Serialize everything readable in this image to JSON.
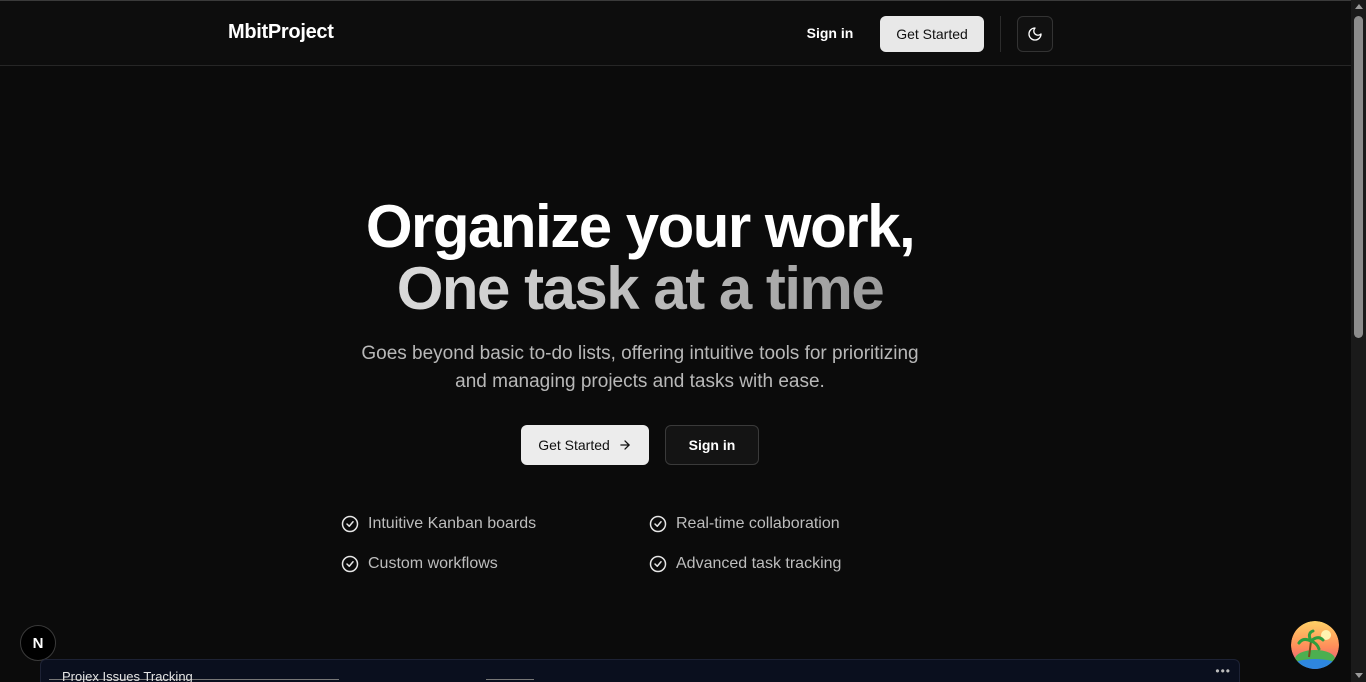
{
  "header": {
    "brand": "MbitProject",
    "sign_in": "Sign in",
    "get_started": "Get Started",
    "theme_icon": "moon-icon"
  },
  "hero": {
    "title_line1": "Organize your work,",
    "title_line2": "One task at a time",
    "subtitle_line1": "Goes beyond basic to-do lists, offering intuitive tools for prioritizing",
    "subtitle_line2": "and managing projects and tasks with ease.",
    "cta_primary": "Get Started",
    "cta_primary_icon": "arrow-right-icon",
    "cta_secondary": "Sign in"
  },
  "features": [
    "Intuitive Kanban boards",
    "Real-time collaboration",
    "Custom workflows",
    "Advanced task tracking"
  ],
  "badge": {
    "letter": "N"
  },
  "preview": {
    "title": "Projex Issues Tracking",
    "menu_icon": "more-horizontal-icon"
  },
  "colors": {
    "background": "#0b0b0b",
    "primary_button": "#ececec",
    "text_muted": "#b8b8b8"
  }
}
